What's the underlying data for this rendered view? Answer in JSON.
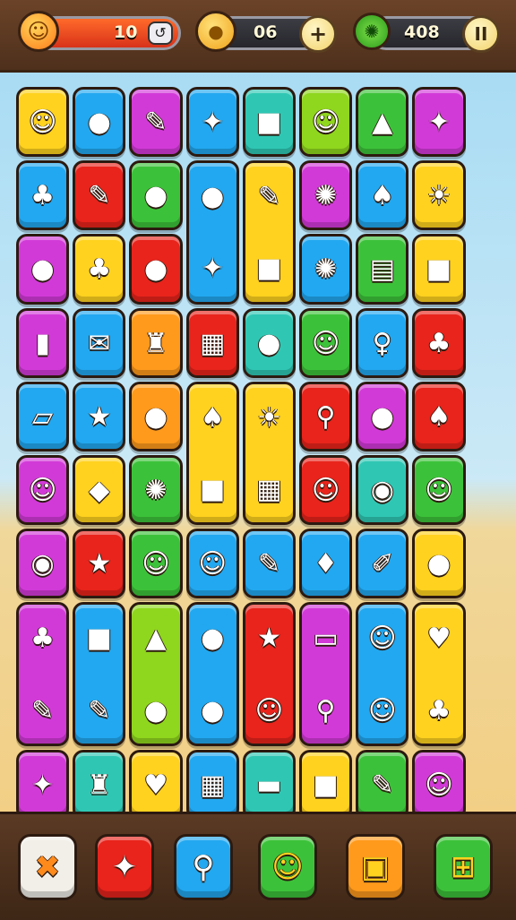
{
  "hud": {
    "level_value": "10",
    "coins_value": "06",
    "gems_value": "408",
    "add_label": "+",
    "pause_label": "II",
    "level_icon": "sun-face-icon",
    "coins_icon": "coin-icon",
    "gems_icon": "green-gear-icon"
  },
  "colors": {
    "yellow": "#ffd21f",
    "blue": "#22a8f0",
    "magenta": "#d23ad8",
    "red": "#e8241c",
    "green": "#3cc23a",
    "lime": "#8fd61e",
    "teal": "#2fc7b4",
    "orange": "#ff9a1c",
    "purple": "#9a42e0"
  },
  "board": {
    "tiles": [
      {
        "r": 0,
        "c": 0,
        "rs": 1,
        "color": "yellow",
        "g": [
          "☺"
        ],
        "name": "face-hat-tile"
      },
      {
        "r": 0,
        "c": 1,
        "rs": 1,
        "color": "blue",
        "g": [
          "●"
        ],
        "name": "red-ball-tile"
      },
      {
        "r": 0,
        "c": 2,
        "rs": 1,
        "color": "magenta",
        "g": [
          "✎"
        ],
        "name": "pen-tile"
      },
      {
        "r": 0,
        "c": 3,
        "rs": 1,
        "color": "blue",
        "g": [
          "✦"
        ],
        "name": "star-shape-tile"
      },
      {
        "r": 0,
        "c": 4,
        "rs": 1,
        "color": "teal",
        "g": [
          "■"
        ],
        "name": "cube-tile"
      },
      {
        "r": 0,
        "c": 5,
        "rs": 1,
        "color": "lime",
        "g": [
          "☺"
        ],
        "name": "acorn-face-tile"
      },
      {
        "r": 0,
        "c": 6,
        "rs": 1,
        "color": "green",
        "g": [
          "▲"
        ],
        "name": "cone-tile"
      },
      {
        "r": 0,
        "c": 7,
        "rs": 1,
        "color": "magenta",
        "g": [
          "✦"
        ],
        "name": "crystal-tile"
      },
      {
        "r": 1,
        "c": 0,
        "rs": 1,
        "color": "blue",
        "g": [
          "♣"
        ],
        "name": "leaf-tile"
      },
      {
        "r": 1,
        "c": 1,
        "rs": 1,
        "color": "red",
        "g": [
          "✎"
        ],
        "name": "pencil-tile"
      },
      {
        "r": 1,
        "c": 2,
        "rs": 1,
        "color": "green",
        "g": [
          "●"
        ],
        "name": "green-fruit-tile"
      },
      {
        "r": 1,
        "c": 3,
        "rs": 2,
        "color": "blue",
        "g": [
          "●",
          "✦"
        ],
        "name": "coin-star-tall-tile"
      },
      {
        "r": 1,
        "c": 4,
        "rs": 2,
        "color": "yellow",
        "g": [
          "✎",
          "■"
        ],
        "name": "pencil-block-tall-tile"
      },
      {
        "r": 1,
        "c": 5,
        "rs": 1,
        "color": "magenta",
        "g": [
          "✺"
        ],
        "name": "gear-tile"
      },
      {
        "r": 1,
        "c": 6,
        "rs": 1,
        "color": "blue",
        "g": [
          "♠"
        ],
        "name": "racket-tile"
      },
      {
        "r": 1,
        "c": 7,
        "rs": 1,
        "color": "yellow",
        "g": [
          "☀"
        ],
        "name": "sun-tile"
      },
      {
        "r": 2,
        "c": 0,
        "rs": 1,
        "color": "magenta",
        "g": [
          "●"
        ],
        "name": "apple-tile"
      },
      {
        "r": 2,
        "c": 1,
        "rs": 1,
        "color": "yellow",
        "g": [
          "♣"
        ],
        "name": "palm-tile"
      },
      {
        "r": 2,
        "c": 2,
        "rs": 1,
        "color": "red",
        "g": [
          "●"
        ],
        "name": "lime-egg-tile"
      },
      {
        "r": 2,
        "c": 5,
        "rs": 1,
        "color": "blue",
        "g": [
          "✺"
        ],
        "name": "virus-tile"
      },
      {
        "r": 2,
        "c": 6,
        "rs": 1,
        "color": "green",
        "g": [
          "▤"
        ],
        "name": "battery-tile"
      },
      {
        "r": 2,
        "c": 7,
        "rs": 1,
        "color": "yellow",
        "g": [
          "■"
        ],
        "name": "box-tile"
      },
      {
        "r": 3,
        "c": 0,
        "rs": 1,
        "color": "magenta",
        "g": [
          "▮"
        ],
        "name": "jar-tile"
      },
      {
        "r": 3,
        "c": 1,
        "rs": 1,
        "color": "blue",
        "g": [
          "✉"
        ],
        "name": "note-tile"
      },
      {
        "r": 3,
        "c": 2,
        "rs": 1,
        "color": "orange",
        "g": [
          "♜"
        ],
        "name": "cup-tile"
      },
      {
        "r": 3,
        "c": 3,
        "rs": 1,
        "color": "red",
        "g": [
          "▦"
        ],
        "name": "book-tile"
      },
      {
        "r": 3,
        "c": 4,
        "rs": 1,
        "color": "teal",
        "g": [
          "●"
        ],
        "name": "purple-orb-tile"
      },
      {
        "r": 3,
        "c": 5,
        "rs": 1,
        "color": "green",
        "g": [
          "☺"
        ],
        "name": "bug-face-tile"
      },
      {
        "r": 3,
        "c": 6,
        "rs": 1,
        "color": "blue",
        "g": [
          "♀"
        ],
        "name": "pin-tile"
      },
      {
        "r": 3,
        "c": 7,
        "rs": 1,
        "color": "red",
        "g": [
          "♣"
        ],
        "name": "leaf-red-tile"
      },
      {
        "r": 4,
        "c": 0,
        "rs": 1,
        "color": "blue",
        "g": [
          "▱"
        ],
        "name": "eraser-tile"
      },
      {
        "r": 4,
        "c": 1,
        "rs": 1,
        "color": "blue",
        "g": [
          "★"
        ],
        "name": "star-face-tile"
      },
      {
        "r": 4,
        "c": 2,
        "rs": 1,
        "color": "orange",
        "g": [
          "●"
        ],
        "name": "green-bean-tile"
      },
      {
        "r": 4,
        "c": 3,
        "rs": 2,
        "color": "yellow",
        "g": [
          "♠",
          "■"
        ],
        "name": "leaf-block-tall-tile"
      },
      {
        "r": 4,
        "c": 4,
        "rs": 2,
        "color": "yellow",
        "g": [
          "☀",
          "▦"
        ],
        "name": "sun-chart-tall-tile"
      },
      {
        "r": 4,
        "c": 5,
        "rs": 1,
        "color": "red",
        "g": [
          "⚲"
        ],
        "name": "key-tile"
      },
      {
        "r": 4,
        "c": 6,
        "rs": 1,
        "color": "magenta",
        "g": [
          "●"
        ],
        "name": "ball-tile"
      },
      {
        "r": 4,
        "c": 7,
        "rs": 1,
        "color": "red",
        "g": [
          "♠"
        ],
        "name": "spoon-tile"
      },
      {
        "r": 5,
        "c": 0,
        "rs": 1,
        "color": "magenta",
        "g": [
          "☺"
        ],
        "name": "chick-tile"
      },
      {
        "r": 5,
        "c": 1,
        "rs": 1,
        "color": "yellow",
        "g": [
          "◆"
        ],
        "name": "ticket-tile"
      },
      {
        "r": 5,
        "c": 2,
        "rs": 1,
        "color": "green",
        "g": [
          "✺"
        ],
        "name": "red-flower-tile"
      },
      {
        "r": 5,
        "c": 5,
        "rs": 1,
        "color": "red",
        "g": [
          "☺"
        ],
        "name": "yellow-bird-tile"
      },
      {
        "r": 5,
        "c": 6,
        "rs": 1,
        "color": "teal",
        "g": [
          "◉"
        ],
        "name": "ring-tile"
      },
      {
        "r": 5,
        "c": 7,
        "rs": 1,
        "color": "green",
        "g": [
          "☺"
        ],
        "name": "cat-face-tile"
      },
      {
        "r": 6,
        "c": 0,
        "rs": 1,
        "color": "magenta",
        "g": [
          "◉"
        ],
        "name": "eye-monster-tile"
      },
      {
        "r": 6,
        "c": 1,
        "rs": 1,
        "color": "red",
        "g": [
          "★"
        ],
        "name": "star-tile"
      },
      {
        "r": 6,
        "c": 2,
        "rs": 1,
        "color": "green",
        "g": [
          "☺"
        ],
        "name": "ghost-face-tile"
      },
      {
        "r": 6,
        "c": 3,
        "rs": 1,
        "color": "blue",
        "g": [
          "☺"
        ],
        "name": "cap-face-tile"
      },
      {
        "r": 6,
        "c": 4,
        "rs": 1,
        "color": "blue",
        "g": [
          "✎"
        ],
        "name": "orange-pencil-tile"
      },
      {
        "r": 6,
        "c": 5,
        "rs": 1,
        "color": "blue",
        "g": [
          "♦"
        ],
        "name": "drop-tile"
      },
      {
        "r": 6,
        "c": 6,
        "rs": 1,
        "color": "blue",
        "g": [
          "✐"
        ],
        "name": "brush-tile"
      },
      {
        "r": 6,
        "c": 7,
        "rs": 1,
        "color": "yellow",
        "g": [
          "●"
        ],
        "name": "shell-tile"
      },
      {
        "r": 7,
        "c": 0,
        "rs": 2,
        "color": "magenta",
        "g": [
          "♣",
          "✎"
        ],
        "name": "gecko-pencil-tall-tile"
      },
      {
        "r": 7,
        "c": 1,
        "rs": 2,
        "color": "blue",
        "g": [
          "■",
          "✎"
        ],
        "name": "box-crayon-tall-tile"
      },
      {
        "r": 7,
        "c": 2,
        "rs": 2,
        "color": "lime",
        "g": [
          "▲",
          "●"
        ],
        "name": "cone-apple-tall-tile"
      },
      {
        "r": 7,
        "c": 3,
        "rs": 2,
        "color": "blue",
        "g": [
          "●",
          "●"
        ],
        "name": "banana-tall-tile"
      },
      {
        "r": 7,
        "c": 4,
        "rs": 2,
        "color": "red",
        "g": [
          "★",
          "☺"
        ],
        "name": "star-face-tall-tile"
      },
      {
        "r": 7,
        "c": 5,
        "rs": 2,
        "color": "magenta",
        "g": [
          "▭",
          "⚲"
        ],
        "name": "switch-key-tall-tile"
      },
      {
        "r": 7,
        "c": 6,
        "rs": 2,
        "color": "blue",
        "g": [
          "☺",
          "☺"
        ],
        "name": "chick-bug-tall-tile"
      },
      {
        "r": 7,
        "c": 7,
        "rs": 2,
        "color": "yellow",
        "g": [
          "♥",
          "♣"
        ],
        "name": "heart-palm-tall-tile"
      },
      {
        "r": 9,
        "c": 0,
        "rs": 1,
        "color": "magenta",
        "g": [
          "✦"
        ],
        "name": "sparkle-tile"
      },
      {
        "r": 9,
        "c": 1,
        "rs": 1,
        "color": "teal",
        "g": [
          "♜"
        ],
        "name": "robot-tile"
      },
      {
        "r": 9,
        "c": 2,
        "rs": 1,
        "color": "yellow",
        "g": [
          "♥"
        ],
        "name": "heart-tile"
      },
      {
        "r": 9,
        "c": 3,
        "rs": 1,
        "color": "blue",
        "g": [
          "▦"
        ],
        "name": "clipboard-tile"
      },
      {
        "r": 9,
        "c": 4,
        "rs": 1,
        "color": "teal",
        "g": [
          "▬"
        ],
        "name": "roll-tile"
      },
      {
        "r": 9,
        "c": 5,
        "rs": 1,
        "color": "yellow",
        "g": [
          "■"
        ],
        "name": "purple-note-tile"
      },
      {
        "r": 9,
        "c": 6,
        "rs": 1,
        "color": "green",
        "g": [
          "✎"
        ],
        "name": "yellow-crayon-tile"
      },
      {
        "r": 9,
        "c": 7,
        "rs": 1,
        "color": "magenta",
        "g": [
          "☺"
        ],
        "name": "bucket-face-tile"
      }
    ]
  },
  "toolbar": {
    "tools": [
      {
        "color": "#f2efe8",
        "icon": "✖",
        "name": "shuffle-cancel-button",
        "iconColor": "#ff8a1c"
      },
      {
        "color": "#e8241c",
        "icon": "✦",
        "name": "hint-arrow-button",
        "iconColor": "#ffffff"
      },
      {
        "color": "#22a8f0",
        "icon": "⚲",
        "name": "magnifier-button",
        "iconColor": "#ffffff"
      },
      {
        "color": "#3cc23a",
        "icon": "☺",
        "name": "bag-button",
        "iconColor": "#ffd21f"
      },
      {
        "color": "#ff9a1c",
        "icon": "▣",
        "name": "maze-button",
        "iconColor": "#ffd21f"
      },
      {
        "color": "#3cc23a",
        "icon": "⊞",
        "name": "grid-button",
        "iconColor": "#ffd21f"
      }
    ]
  }
}
